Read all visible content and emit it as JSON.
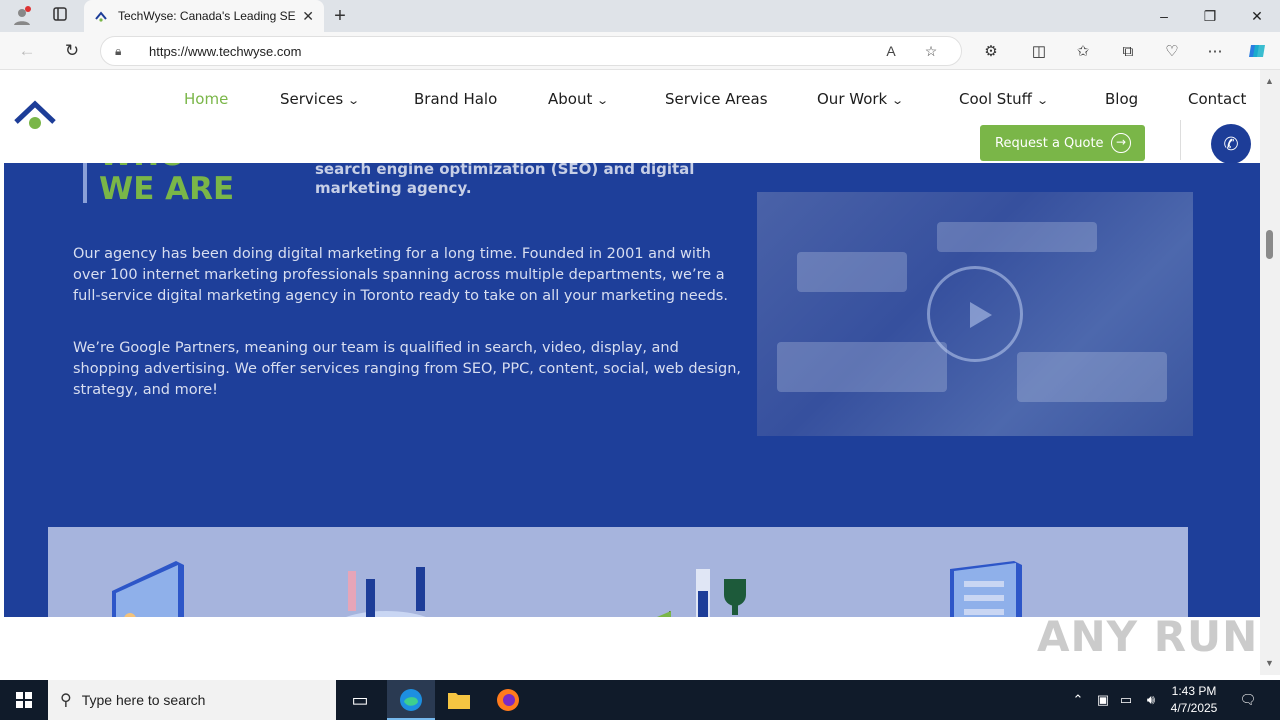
{
  "browser": {
    "tab_title": "TechWyse: Canada's Leading SEO",
    "url": "https://www.techwyse.com",
    "new_tab": "+",
    "close_tab": "✕"
  },
  "site": {
    "nav": [
      {
        "label": "Home",
        "active": true
      },
      {
        "label": "Services",
        "dropdown": true
      },
      {
        "label": "Brand Halo"
      },
      {
        "label": "About",
        "dropdown": true
      },
      {
        "label": "Service Areas"
      },
      {
        "label": "Our Work",
        "dropdown": true
      },
      {
        "label": "Cool Stuff",
        "dropdown": true
      },
      {
        "label": "Blog"
      },
      {
        "label": "Contact"
      }
    ],
    "quote_button": "Request a Quote",
    "hero": {
      "title_line1": "WHO",
      "title_line2": "WE ARE",
      "subtitle": "search engine optimization (SEO) and digital marketing agency.",
      "para1": "Our agency has been doing digital marketing for a long time. Founded in 2001 and with over 100 internet marketing professionals spanning across multiple departments, we’re a full-service digital marketing agency in Toronto ready to take on all your marketing needs.",
      "para2": "We’re Google Partners, meaning our team is qualified in search, video, display, and shopping advertising. We offer services ranging from SEO, PPC, content, social, web design, strategy, and more!"
    }
  },
  "watermark": "ANY RUN",
  "taskbar": {
    "search_placeholder": "Type here to search",
    "time": "1:43 PM",
    "date": "4/7/2025"
  },
  "colors": {
    "brand_green": "#7ab648",
    "brand_blue": "#1e3f9a",
    "nav_dark_blue": "#1d3d98"
  }
}
